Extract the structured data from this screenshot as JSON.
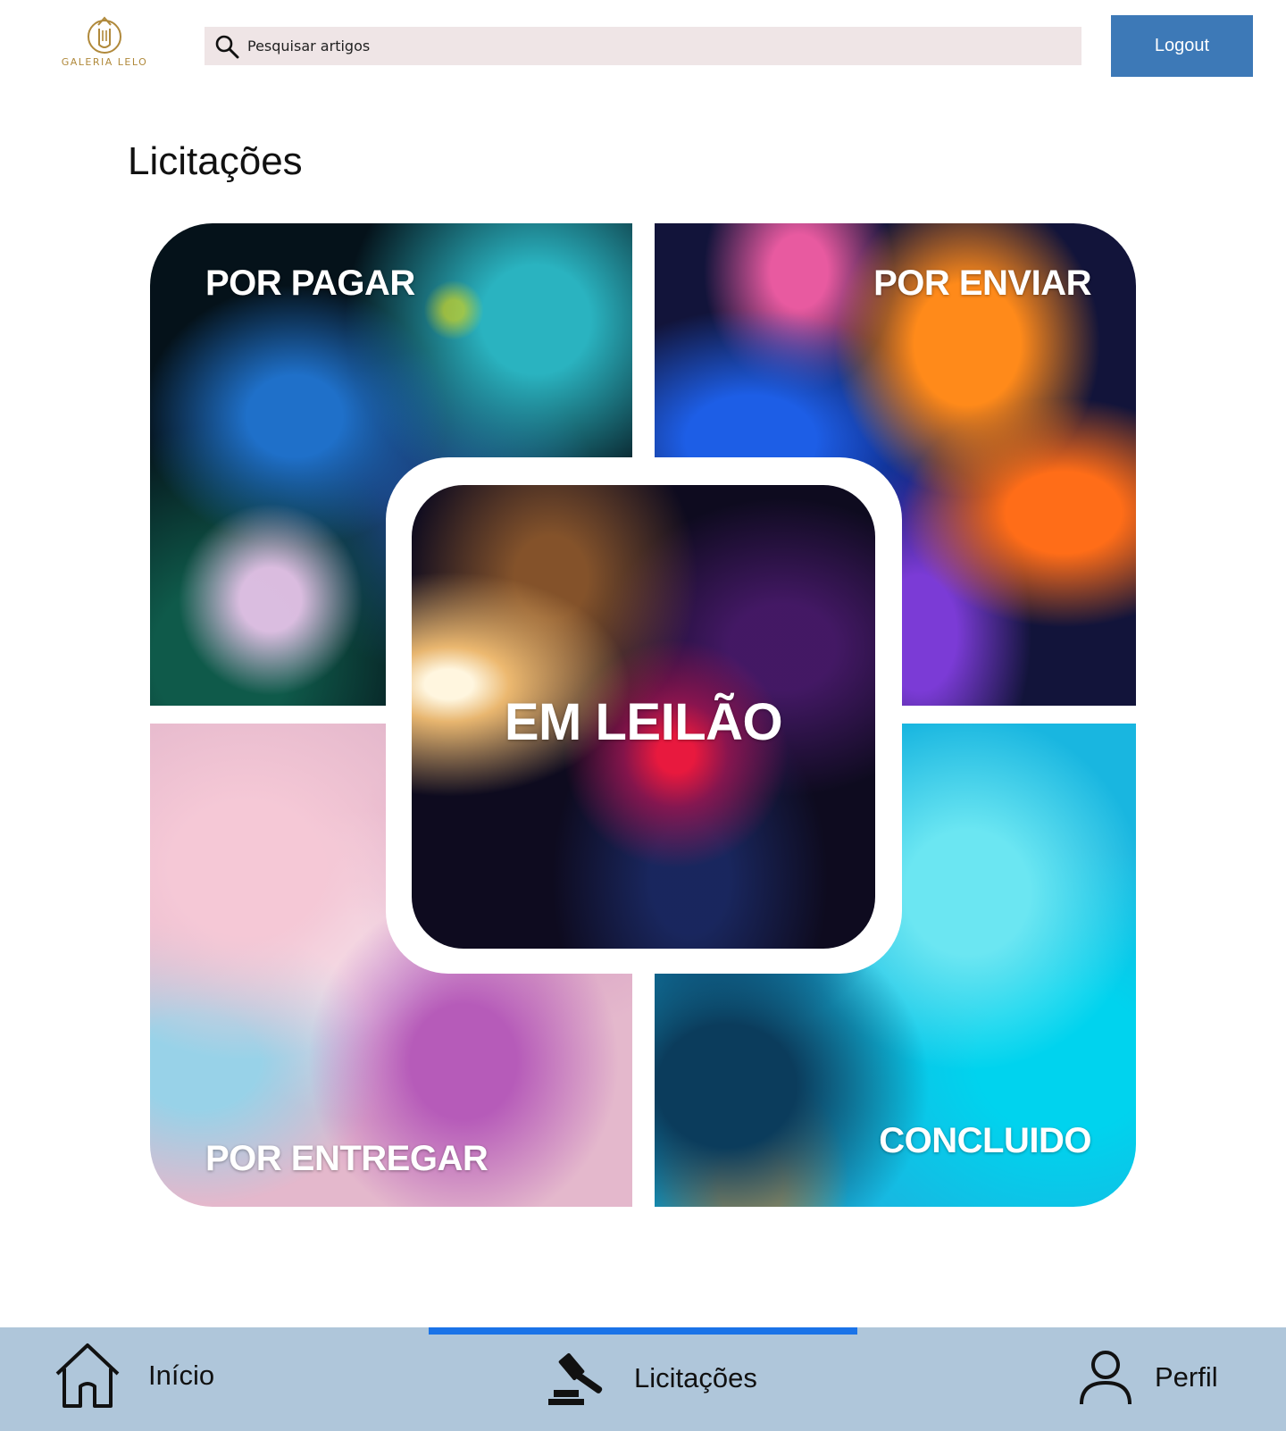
{
  "header": {
    "logo_text": "GALERIA LELO",
    "search": {
      "placeholder": "Pesquisar artigos",
      "icon": "search-icon"
    },
    "logout_label": "Logout"
  },
  "page": {
    "title": "Licitações"
  },
  "tiles": {
    "por_pagar": "POR PAGAR",
    "por_enviar": "POR ENVIAR",
    "em_leilao": "EM LEILÃO",
    "por_entregar": "POR ENTREGAR",
    "concluido": "CONCLUIDO"
  },
  "bottom_nav": {
    "items": [
      {
        "label": "Início",
        "icon": "home-icon",
        "active": false
      },
      {
        "label": "Licitações",
        "icon": "gavel-icon",
        "active": true
      },
      {
        "label": "Perfil",
        "icon": "user-icon",
        "active": false
      }
    ]
  },
  "colors": {
    "logout_bg": "#3d79b7",
    "search_bg": "#efe5e6",
    "nav_bg": "#afc6da",
    "nav_active": "#1a73e8",
    "logo_gold": "#b0893b"
  }
}
